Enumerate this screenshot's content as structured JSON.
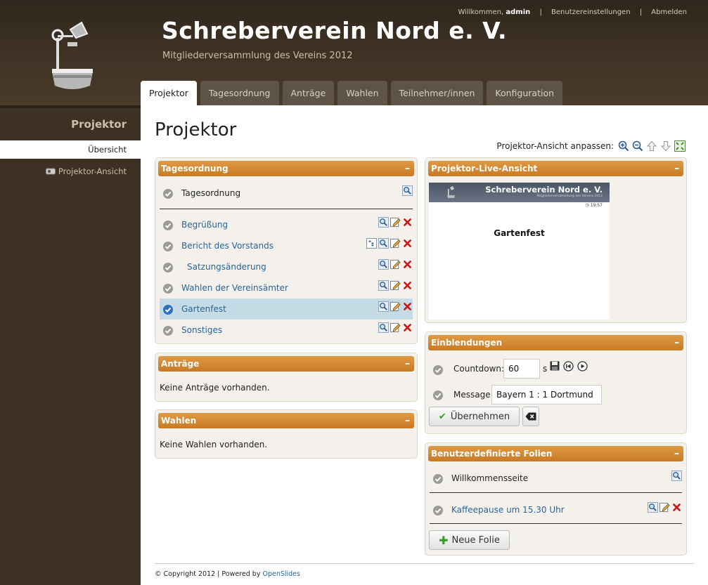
{
  "header": {
    "title": "Schreberverein Nord e. V.",
    "subtitle": "Mitgliederversammlung des Vereins 2012",
    "welcome_prefix": "Willkommen,",
    "username": "admin",
    "separator": "|",
    "user_settings": "Benutzereinstellungen",
    "logout": "Abmelden"
  },
  "tabs": [
    {
      "label": "Projektor",
      "active": true
    },
    {
      "label": "Tagesordnung"
    },
    {
      "label": "Anträge"
    },
    {
      "label": "Wahlen"
    },
    {
      "label": "Teilnehmer/innen"
    },
    {
      "label": "Konfiguration"
    }
  ],
  "sidebar": {
    "title": "Projektor",
    "items": [
      {
        "label": "Übersicht",
        "active": true
      },
      {
        "label": "Projektor-Ansicht",
        "icon": "projector-icon"
      }
    ]
  },
  "main": {
    "title": "Projektor",
    "zoom_label": "Projektor-Ansicht anpassen:"
  },
  "agenda": {
    "title": "Tagesordnung",
    "collapse": "–",
    "header_item": "Tagesordnung",
    "items": [
      {
        "label": "Begrüßung"
      },
      {
        "label": "Bericht des Vorstands",
        "has_tree": true
      },
      {
        "label": "Satzungsänderung",
        "indent": true
      },
      {
        "label": "Wahlen der Vereinsämter"
      },
      {
        "label": "Gartenfest",
        "active": true
      },
      {
        "label": "Sonstiges"
      }
    ]
  },
  "motions": {
    "title": "Anträge",
    "collapse": "–",
    "empty": "Keine Anträge vorhanden."
  },
  "elections": {
    "title": "Wahlen",
    "collapse": "–",
    "empty": "Keine Wahlen vorhanden."
  },
  "live": {
    "title": "Projektor-Live-Ansicht",
    "collapse": "–",
    "preview_title": "Schreberverein Nord e. V.",
    "preview_subtitle": "Mitgliederversammlung des Vereins 2012",
    "preview_time": "19:57",
    "preview_slide": "Gartenfest"
  },
  "overlays": {
    "title": "Einblendungen",
    "collapse": "–",
    "countdown_label": "Countdown:",
    "countdown_value": "60",
    "countdown_unit": "s",
    "message_label": "Message:",
    "message_value": "Bayern 1 : 1 Dortmund",
    "apply_button": "Übernehmen"
  },
  "custom_slides": {
    "title": "Benutzerdefinierte Folien",
    "collapse": "–",
    "header_item": "Willkommensseite",
    "items": [
      {
        "label": "Kaffeepause um 15.30 Uhr"
      }
    ],
    "new_button": "Neue Folie"
  },
  "footer": {
    "copyright": "© Copyright 2012 | Powered by",
    "link": "OpenSlides"
  },
  "colors": {
    "accent_orange": "#d4872f",
    "header_brown": "#3d3124",
    "link_blue": "#2a6496",
    "active_row": "#c5dbe6"
  }
}
